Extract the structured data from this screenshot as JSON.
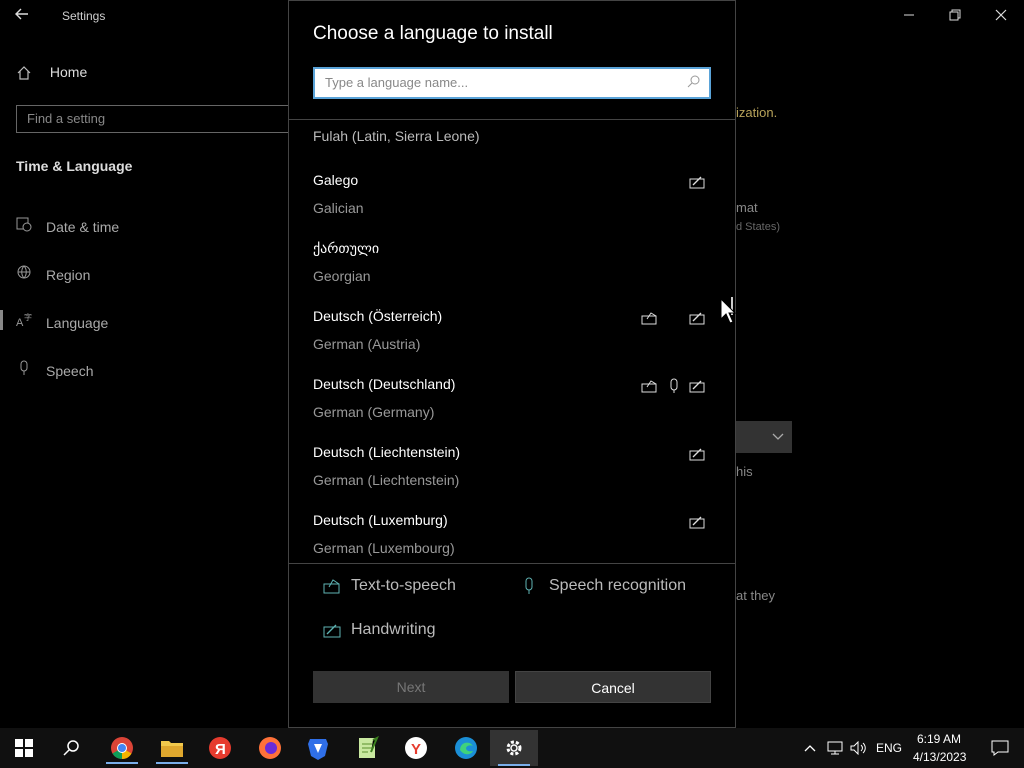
{
  "settings": {
    "title": "Settings",
    "nav_home": "Home",
    "search_placeholder": "Find a setting",
    "section_title": "Time & Language",
    "nav_items": [
      {
        "label": "Date & time",
        "icon": "calendar-clock-icon"
      },
      {
        "label": "Region",
        "icon": "globe-icon"
      },
      {
        "label": "Language",
        "icon": "language-icon"
      },
      {
        "label": "Speech",
        "icon": "microphone-icon"
      }
    ],
    "background_fragments": {
      "ization": "ization.",
      "mat": "mat",
      "d_states": "d States)",
      "his": "his",
      "at_they": "at they"
    }
  },
  "dialog": {
    "title": "Choose a language to install",
    "search_placeholder": "Type a language name...",
    "languages": [
      {
        "native": "Fulah (Latin, Sierra Leone)",
        "english": "",
        "features": []
      },
      {
        "native": "Galego",
        "english": "Galician",
        "features": [
          "handwriting"
        ]
      },
      {
        "native": "ქართული",
        "english": "Georgian",
        "features": []
      },
      {
        "native": "Deutsch (Österreich)",
        "english": "German (Austria)",
        "features": [
          "text-to-speech",
          "handwriting"
        ]
      },
      {
        "native": "Deutsch (Deutschland)",
        "english": "German (Germany)",
        "features": [
          "text-to-speech",
          "speech-recognition",
          "handwriting"
        ]
      },
      {
        "native": "Deutsch (Liechtenstein)",
        "english": "German (Liechtenstein)",
        "features": [
          "handwriting"
        ]
      },
      {
        "native": "Deutsch (Luxemburg)",
        "english": "German (Luxembourg)",
        "features": [
          "handwriting"
        ]
      }
    ],
    "legend": {
      "tts": "Text-to-speech",
      "speech": "Speech recognition",
      "handwriting": "Handwriting"
    },
    "next_label": "Next",
    "cancel_label": "Cancel"
  },
  "taskbar": {
    "apps": [
      "start",
      "search",
      "chrome",
      "file-explorer",
      "yandex-browser",
      "firefox",
      "brave",
      "notepad-plus-plus",
      "yandex",
      "edge",
      "settings"
    ],
    "language": "ENG",
    "time": "6:19 AM",
    "date": "4/13/2023"
  },
  "colors": {
    "accent": "#5aa3d8",
    "icon_teal": "#5fb3b3"
  }
}
